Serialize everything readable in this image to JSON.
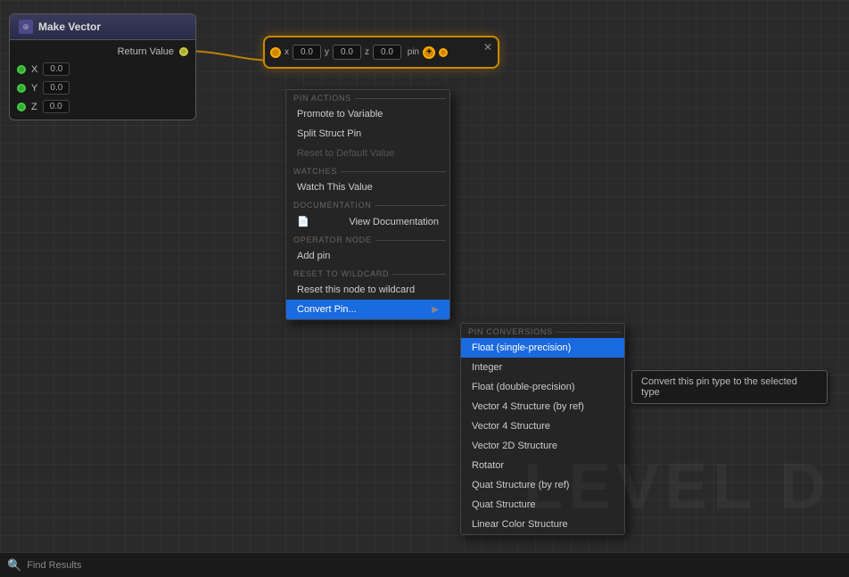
{
  "node": {
    "title": "Make Vector",
    "pins": [
      {
        "axis": "X",
        "value": "0.0"
      },
      {
        "axis": "Y",
        "value": "0.0"
      },
      {
        "axis": "Z",
        "value": "0.0"
      }
    ],
    "return_label": "Return Value"
  },
  "vector_node": {
    "fields": [
      {
        "label": "x",
        "value": "0.0"
      },
      {
        "label": "y",
        "value": "0.0"
      },
      {
        "label": "z",
        "value": "0.0"
      }
    ],
    "pin_label": "pin"
  },
  "context_menu": {
    "sections": [
      {
        "name": "PIN ACTIONS",
        "items": [
          {
            "label": "Promote to Variable",
            "disabled": false
          },
          {
            "label": "Split Struct Pin",
            "disabled": false
          },
          {
            "label": "Reset to Default Value",
            "disabled": true
          }
        ]
      },
      {
        "name": "WATCHES",
        "items": [
          {
            "label": "Watch This Value",
            "disabled": false
          }
        ]
      },
      {
        "name": "DOCUMENTATION",
        "items": [
          {
            "label": "View Documentation",
            "disabled": false,
            "icon": true
          }
        ]
      },
      {
        "name": "OPERATOR NODE",
        "items": [
          {
            "label": "Add pin",
            "disabled": false
          }
        ]
      },
      {
        "name": "RESET TO WILDCARD",
        "items": [
          {
            "label": "Reset this node to wildcard",
            "disabled": false
          }
        ]
      },
      {
        "name": "",
        "items": [
          {
            "label": "Convert Pin...",
            "disabled": false,
            "hasArrow": true,
            "active": true
          }
        ]
      }
    ]
  },
  "pin_conversions": {
    "section": "PIN CONVERSIONS",
    "items": [
      {
        "label": "Float (single-precision)",
        "selected": true
      },
      {
        "label": "Integer",
        "selected": false
      },
      {
        "label": "Float (double-precision)",
        "selected": false
      },
      {
        "label": "Vector 4 Structure (by ref)",
        "selected": false
      },
      {
        "label": "Vector 4 Structure",
        "selected": false
      },
      {
        "label": "Vector 2D Structure",
        "selected": false
      },
      {
        "label": "Rotator",
        "selected": false
      },
      {
        "label": "Quat Structure (by ref)",
        "selected": false
      },
      {
        "label": "Quat Structure",
        "selected": false
      },
      {
        "label": "Linear Color Structure",
        "selected": false
      }
    ]
  },
  "tooltip": {
    "text": "Convert this pin type to the selected type"
  },
  "watermark": "LEVEL D",
  "bottom_bar": {
    "icon": "🔍",
    "label": "Find Results"
  }
}
